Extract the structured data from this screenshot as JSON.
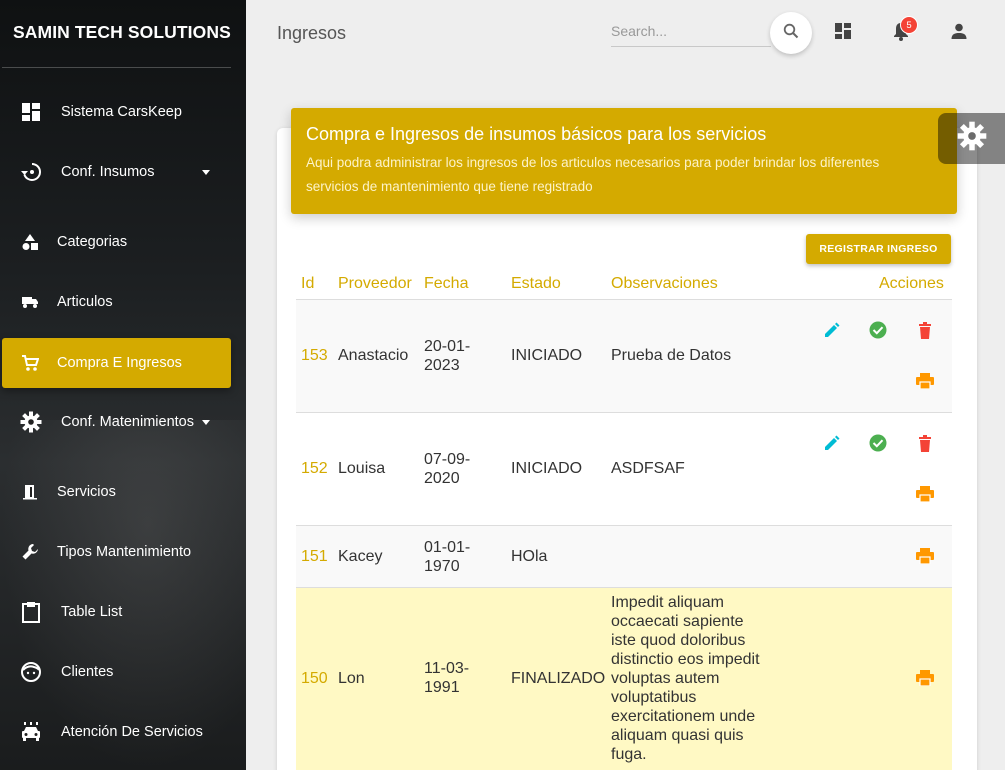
{
  "sidebar": {
    "brand": "SAMIN TECH SOLUTIONS",
    "items": [
      {
        "label": "Sistema CarsKeep",
        "icon": "dashboard-icon"
      },
      {
        "label": "Conf. Insumos",
        "icon": "history-icon"
      },
      {
        "label": "Categorias",
        "icon": "category-icon"
      },
      {
        "label": "Articulos",
        "icon": "truck-icon"
      },
      {
        "label": "Compra E Ingresos",
        "icon": "cart-icon"
      },
      {
        "label": "Conf. Matenimientos",
        "icon": "gear-icon"
      },
      {
        "label": "Servicios",
        "icon": "door-icon"
      },
      {
        "label": "Tipos Mantenimiento",
        "icon": "wrench-icon"
      },
      {
        "label": "Table List",
        "icon": "clipboard-icon"
      },
      {
        "label": "Clientes",
        "icon": "face-icon"
      },
      {
        "label": "Atención De Servicios",
        "icon": "car-icon"
      }
    ]
  },
  "topbar": {
    "title": "Ingresos",
    "search_placeholder": "Search...",
    "notifications_count": "5"
  },
  "card": {
    "title": "Compra e Ingresos de insumos básicos para los servicios",
    "subtitle": "Aqui podra administrar los ingresos de los articulos necesarios para poder brindar los diferentes servicios de mantenimiento que tiene registrado",
    "register_button": "REGISTRAR INGRESO"
  },
  "table": {
    "headers": {
      "id": "Id",
      "proveedor": "Proveedor",
      "fecha": "Fecha",
      "estado": "Estado",
      "observaciones": "Observaciones",
      "acciones": "Acciones"
    },
    "rows": [
      {
        "id": "153",
        "proveedor": "Anastacio",
        "fecha": "20-01-2023",
        "estado": "INICIADO",
        "observaciones": "Prueba de Datos"
      },
      {
        "id": "152",
        "proveedor": "Louisa",
        "fecha": "07-09-2020",
        "estado": "INICIADO",
        "observaciones": "ASDFSAF"
      },
      {
        "id": "151",
        "proveedor": "Kacey",
        "fecha": "01-01-1970",
        "estado": "HOla",
        "observaciones": ""
      },
      {
        "id": "150",
        "proveedor": "Lon",
        "fecha": "11-03-1991",
        "estado": "FINALIZADO",
        "observaciones": "Impedit aliquam occaecati sapiente iste quod doloribus distinctio eos impedit voluptas autem voluptatibus exercitationem unde aliquam quasi quis fuga."
      }
    ]
  },
  "colors": {
    "accent": "#d4aa00",
    "edit": "#00bcd4",
    "approve": "#4caf50",
    "delete": "#f44336",
    "print": "#ff9800"
  }
}
